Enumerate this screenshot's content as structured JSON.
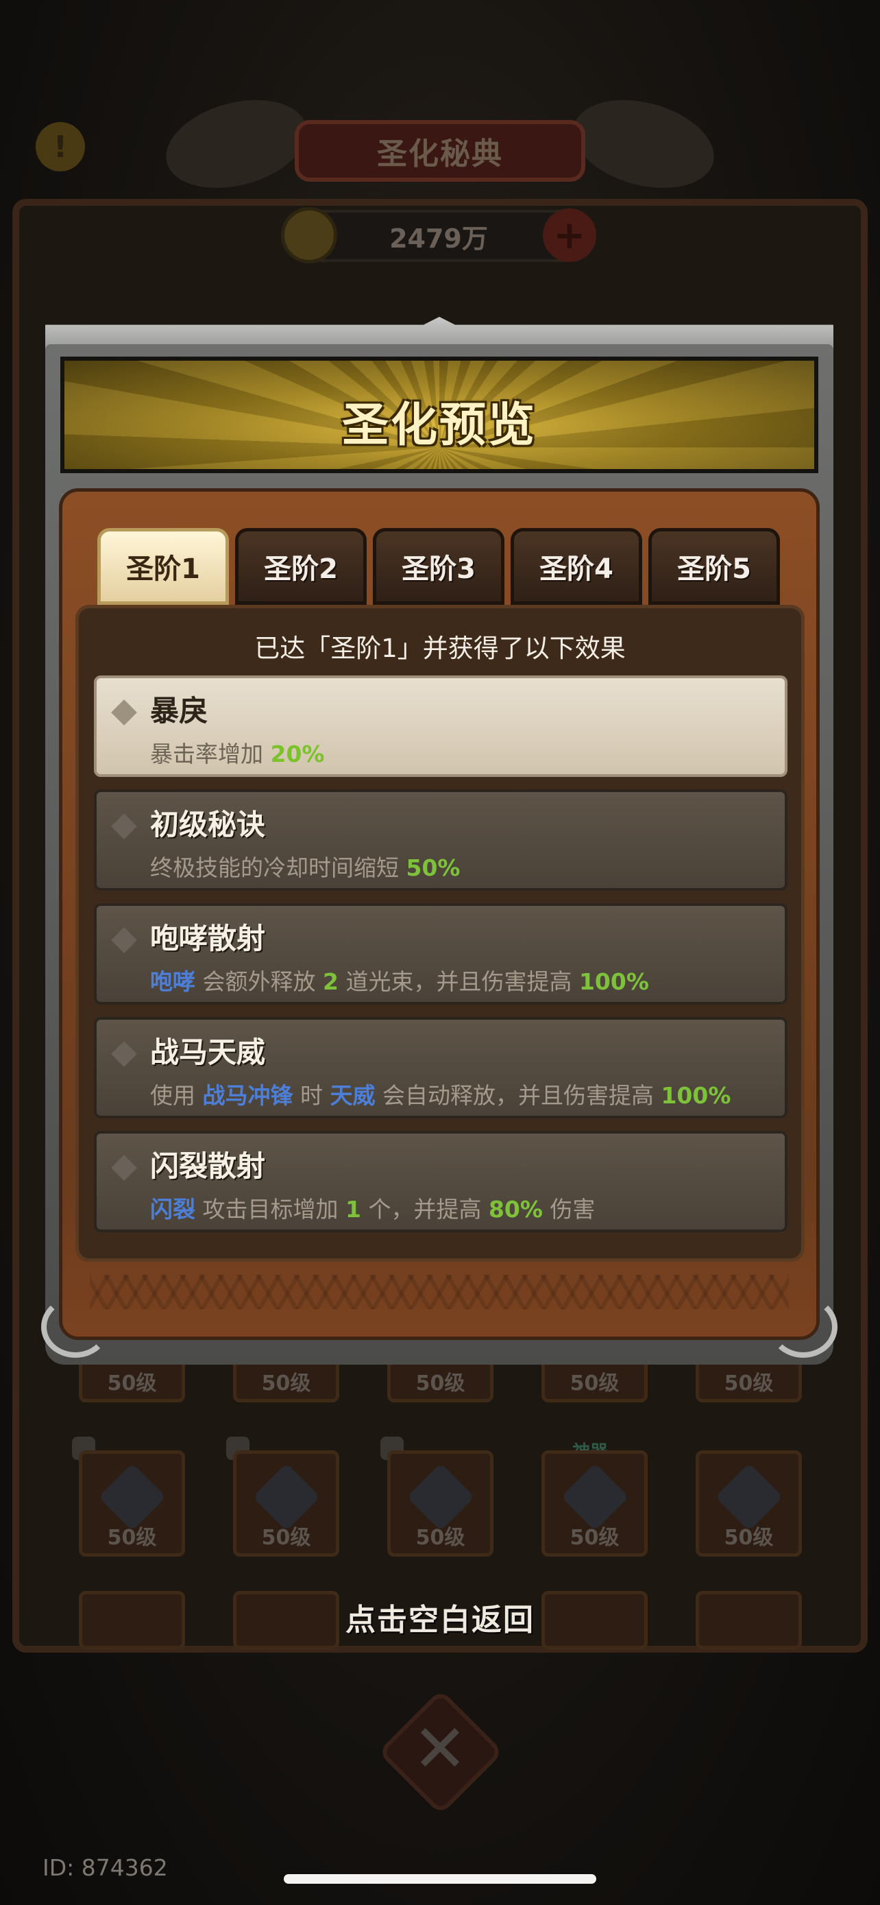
{
  "background": {
    "header_title": "圣化秘典",
    "coin_amount": "2479万",
    "level_badges": [
      "50级",
      "50级",
      "50级",
      "50级",
      "50级",
      "50级",
      "50级",
      "50级",
      "50级",
      "50级"
    ],
    "god_tag": "神器"
  },
  "panel": {
    "title": "圣化预览",
    "tabs": [
      {
        "label": "圣阶1",
        "active": true
      },
      {
        "label": "圣阶2",
        "active": false
      },
      {
        "label": "圣阶3",
        "active": false
      },
      {
        "label": "圣阶4",
        "active": false
      },
      {
        "label": "圣阶5",
        "active": false
      }
    ],
    "subtitle": "已达「圣阶1」并获得了以下效果",
    "effects": [
      {
        "name": "暴戾",
        "desc_1": "暴击率增加 ",
        "value_1": "20%"
      },
      {
        "name": "初级秘诀",
        "desc_1": "终极技能的冷却时间缩短 ",
        "value_1": "50%"
      },
      {
        "name": "咆哮散射",
        "kw_1": "咆哮",
        "desc_1": " 会额外释放 ",
        "value_1": "2",
        "desc_2": " 道光束，并且伤害提高 ",
        "value_2": "100%"
      },
      {
        "name": "战马天威",
        "desc_0": "使用 ",
        "kw_1": "战马冲锋",
        "desc_1": " 时 ",
        "kw_2": "天威",
        "desc_2": " 会自动释放，并且伤害提高 ",
        "value_2": "100%"
      },
      {
        "name": "闪裂散射",
        "kw_1": "闪裂",
        "desc_1": " 攻击目标增加 ",
        "value_1": "1",
        "desc_2": " 个，并提高 ",
        "value_2": "80%",
        "desc_3": " 伤害"
      }
    ]
  },
  "dismiss_hint": "点击空白返回",
  "user_id": "ID: 874362",
  "colors": {
    "accent_gold": "#d9b53a",
    "value_green": "#7dc23a",
    "keyword_blue": "#4d7fd8"
  }
}
